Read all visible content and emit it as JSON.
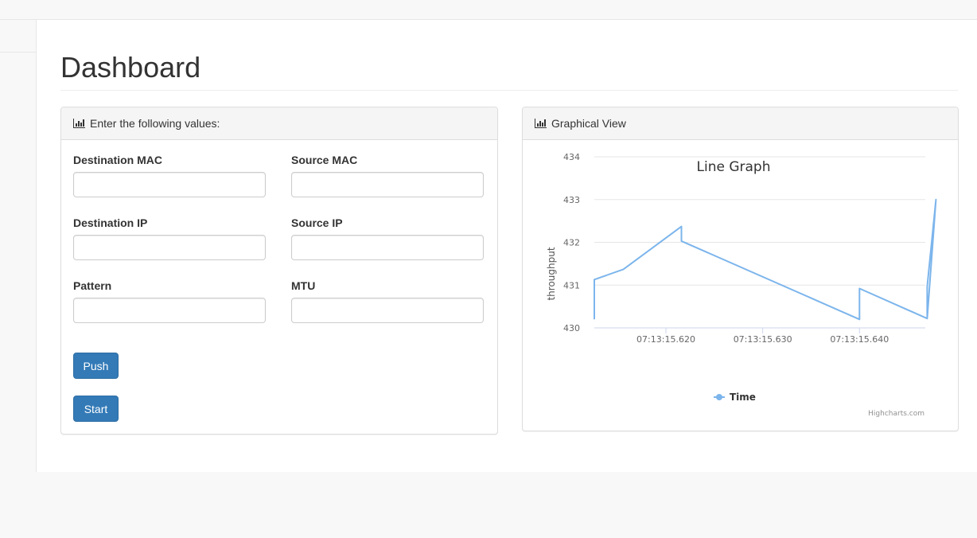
{
  "page": {
    "title": "Dashboard"
  },
  "form_panel": {
    "heading": "Enter the following values:",
    "heading_icon": "bar-chart-icon",
    "fields": [
      {
        "label": "Destination MAC",
        "value": "",
        "placeholder": ""
      },
      {
        "label": "Source MAC",
        "value": "",
        "placeholder": ""
      },
      {
        "label": "Destination IP",
        "value": "",
        "placeholder": ""
      },
      {
        "label": "Source IP",
        "value": "",
        "placeholder": ""
      },
      {
        "label": "Pattern",
        "value": "",
        "placeholder": ""
      },
      {
        "label": "MTU",
        "value": "",
        "placeholder": ""
      }
    ],
    "push_label": "Push",
    "start_label": "Start",
    "button_color": "#337ab7"
  },
  "chart_panel": {
    "heading": "Graphical View",
    "heading_icon": "bar-chart-icon",
    "credits": "Highcharts.com"
  },
  "chart_data": {
    "type": "line",
    "title": "Line Graph",
    "xlabel": "",
    "ylabel": "throughput",
    "ylim": [
      430,
      434
    ],
    "yticks": [
      "430",
      "431",
      "432",
      "433",
      "434"
    ],
    "xlim": [
      15.6126,
      15.6468
    ],
    "xticks": [
      {
        "value": 15.62,
        "label": "07:13:15.620"
      },
      {
        "value": 15.63,
        "label": "07:13:15.630"
      },
      {
        "value": 15.64,
        "label": "07:13:15.640"
      }
    ],
    "grid": true,
    "legend_position": "bottom-center",
    "series": [
      {
        "name": "Time",
        "color": "#7cb5ec",
        "points": [
          [
            15.6126,
            430.2
          ],
          [
            15.6126,
            431.13
          ],
          [
            15.6156,
            431.37
          ],
          [
            15.6216,
            432.37
          ],
          [
            15.6216,
            432.03
          ],
          [
            15.64,
            430.2
          ],
          [
            15.64,
            430.92
          ],
          [
            15.647,
            430.22
          ],
          [
            15.647,
            430.97
          ],
          [
            15.6479,
            433.0
          ],
          [
            15.647,
            430.22
          ]
        ]
      }
    ]
  }
}
